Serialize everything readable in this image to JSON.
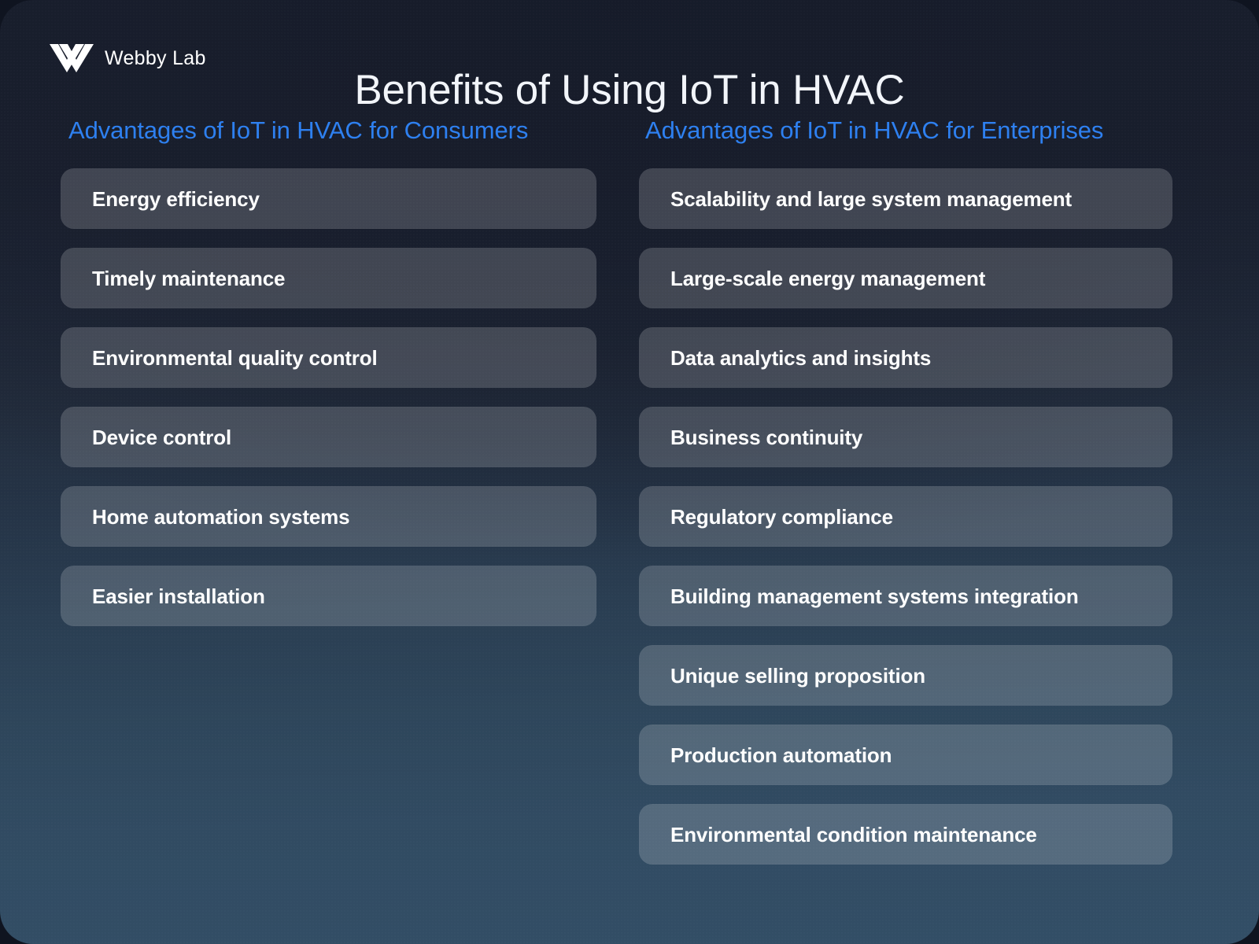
{
  "brand": {
    "name": "Webby Lab",
    "logo_icon": "webbylab-chevron-logo"
  },
  "header": {
    "title": "Benefits of Using IoT in HVAC"
  },
  "colors": {
    "accent_blue": "#2e80f0",
    "title_text": "#f2f5fa",
    "card_text": "#ffffff",
    "background_top": "#1b2130",
    "background_bottom": "#324e66",
    "card_fill": "rgba(255,255,255,0.175)"
  },
  "columns": [
    {
      "heading": "Advantages of IoT in HVAC for Consumers",
      "items": [
        "Energy efficiency",
        "Timely maintenance",
        "Environmental quality control",
        "Device control",
        "Home automation systems",
        "Easier installation"
      ]
    },
    {
      "heading": "Advantages of IoT in HVAC for Enterprises",
      "items": [
        "Scalability and large system management",
        "Large-scale energy management",
        "Data analytics and insights",
        "Business continuity",
        "Regulatory compliance",
        "Building management systems integration",
        "Unique selling proposition",
        "Production automation",
        "Environmental condition maintenance"
      ]
    }
  ]
}
